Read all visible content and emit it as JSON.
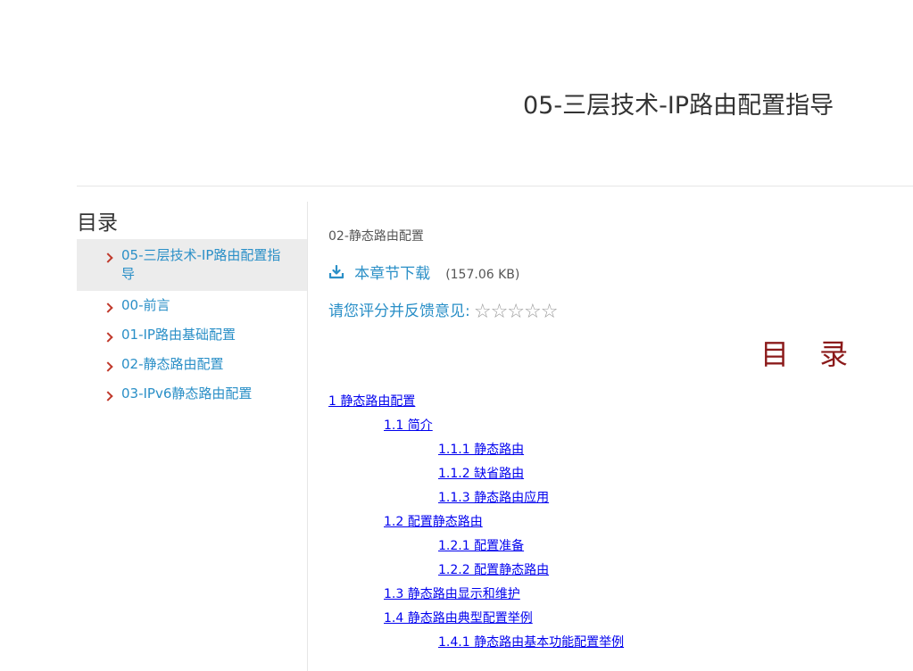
{
  "document": {
    "title": "05-三层技术-IP路由配置指导"
  },
  "sidebar": {
    "heading": "目录",
    "items": [
      {
        "label": "05-三层技术-IP路由配置指导",
        "active": true
      },
      {
        "label": "00-前言"
      },
      {
        "label": "01-IP路由基础配置"
      },
      {
        "label": "02-静态路由配置"
      },
      {
        "label": "03-IPv6静态路由配置"
      }
    ]
  },
  "main": {
    "chapter_name": "02-静态路由配置",
    "download_label": "本章节下载",
    "download_size": "(157.06 KB)",
    "rating_label": "请您评分并反馈意见:",
    "rating_stars": [
      "☆",
      "☆",
      "☆",
      "☆",
      "☆"
    ],
    "toc_heading": "目 录",
    "toc": [
      {
        "label": "1 静态路由配置",
        "level": 1
      },
      {
        "label": "1.1 简介",
        "level": 2
      },
      {
        "label": "1.1.1 静态路由",
        "level": 3
      },
      {
        "label": "1.1.2 缺省路由",
        "level": 3
      },
      {
        "label": "1.1.3 静态路由应用",
        "level": 3
      },
      {
        "label": "1.2 配置静态路由",
        "level": 2
      },
      {
        "label": "1.2.1 配置准备",
        "level": 3
      },
      {
        "label": "1.2.2 配置静态路由",
        "level": 3
      },
      {
        "label": "1.3 静态路由显示和维护",
        "level": 2
      },
      {
        "label": "1.4 静态路由典型配置举例",
        "level": 2
      },
      {
        "label": "1.4.1 静态路由基本功能配置举例",
        "level": 3
      }
    ]
  },
  "colors": {
    "link": "#2a8fc7",
    "toc_link": "#0000ee",
    "toc_heading": "#8b1a1a",
    "chevron": "#c0392b",
    "active_bg": "#ececec"
  }
}
